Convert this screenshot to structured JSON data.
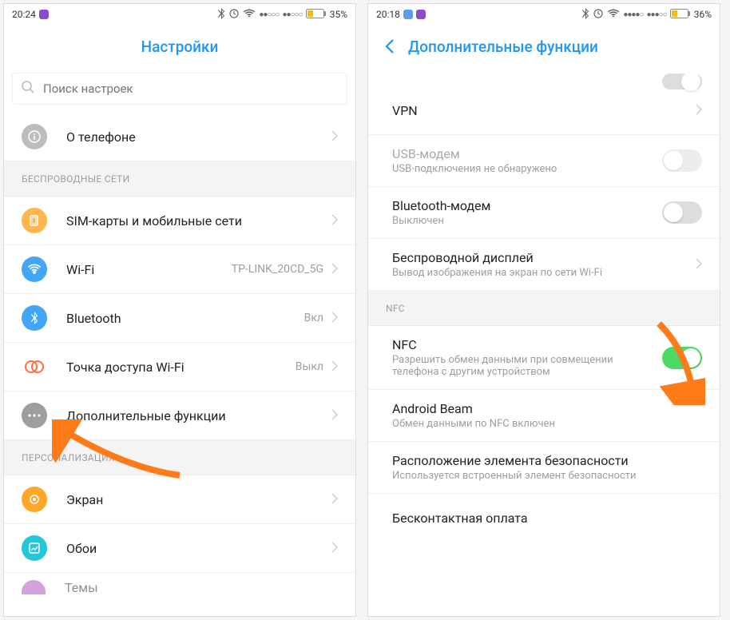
{
  "left": {
    "status": {
      "time": "20:24",
      "battery": "35%"
    },
    "header": {
      "title": "Настройки"
    },
    "search": {
      "placeholder": "Поиск настроек"
    },
    "about": {
      "label": "О телефоне"
    },
    "section_wireless": "БЕСПРОВОДНЫЕ СЕТИ",
    "sim": {
      "label": "SIM-карты и мобильные сети"
    },
    "wifi": {
      "label": "Wi-Fi",
      "value": "TP-LINK_20CD_5G"
    },
    "bluetooth": {
      "label": "Bluetooth",
      "value": "Вкл"
    },
    "hotspot": {
      "label": "Точка доступа Wi-Fi",
      "value": "Выкл"
    },
    "more": {
      "label": "Дополнительные функции"
    },
    "section_personal": "ПЕРСОНАЛИЗАЦИЯ",
    "display": {
      "label": "Экран"
    },
    "wallpaper": {
      "label": "Обои"
    },
    "themes": {
      "label": "Темы"
    }
  },
  "right": {
    "status": {
      "time": "20:18",
      "battery": "36%"
    },
    "header": {
      "title": "Дополнительные функции"
    },
    "vpn": {
      "label": "VPN"
    },
    "usb": {
      "label": "USB-модем",
      "sub": "USB-подключения не обнаружено"
    },
    "btmodem": {
      "label": "Bluetooth-модем",
      "sub": "Выключен"
    },
    "cast": {
      "label": "Беспроводной дисплей",
      "sub": "Вывод изображения на экран по сети Wi-Fi"
    },
    "section_nfc": "NFC",
    "nfc": {
      "label": "NFC",
      "sub": "Разрешить обмен данными при совмещении телефона с другим устройством"
    },
    "beam": {
      "label": "Android Beam",
      "sub": "Обмен данными по NFC включен"
    },
    "secure": {
      "label": "Расположение элемента безопасности",
      "sub": "Используется встроенный элемент безопасности"
    },
    "contactless": {
      "label": "Бесконтактная оплата"
    }
  }
}
